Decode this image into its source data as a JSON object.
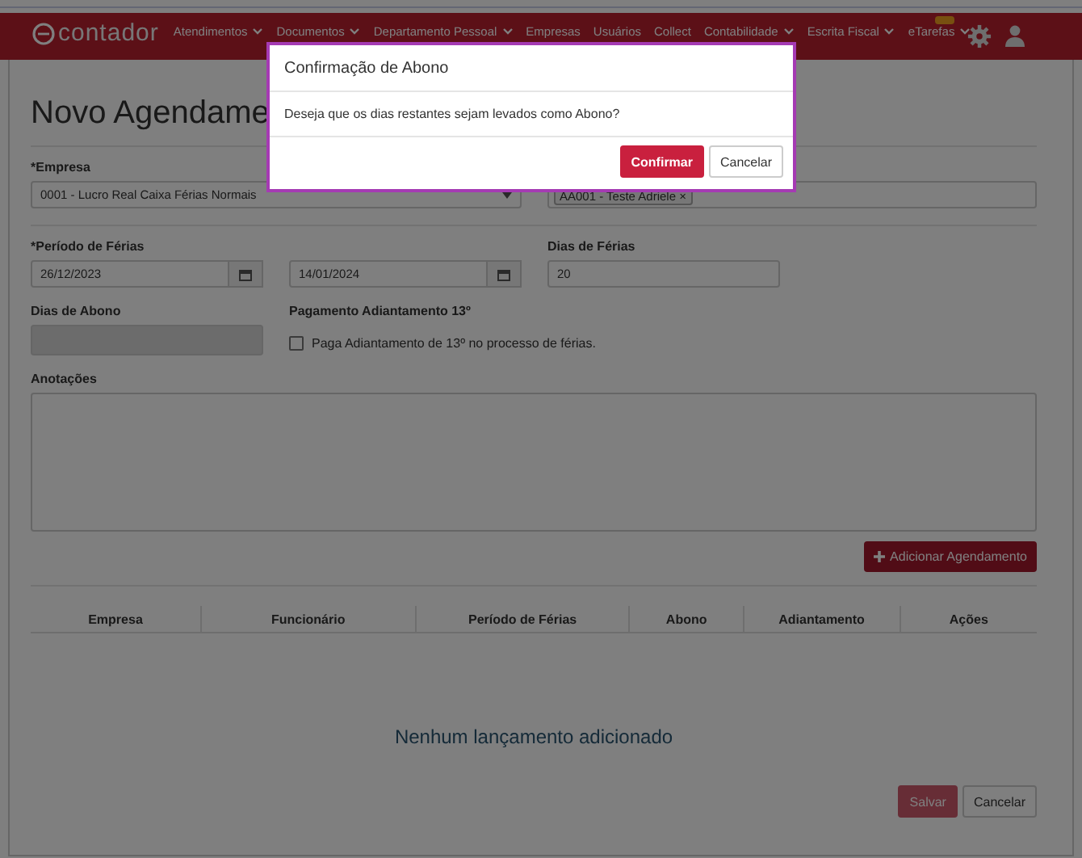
{
  "navbar": {
    "logo": "contador",
    "items": [
      {
        "label": "Atendimentos",
        "dropdown": true
      },
      {
        "label": "Documentos",
        "dropdown": true
      },
      {
        "label": "Departamento Pessoal",
        "dropdown": true
      },
      {
        "label": "Empresas",
        "dropdown": false
      },
      {
        "label": "Usuários",
        "dropdown": false
      },
      {
        "label": "Collect",
        "dropdown": false
      },
      {
        "label": "Contabilidade",
        "dropdown": true
      },
      {
        "label": "Escrita Fiscal",
        "dropdown": true
      },
      {
        "label": "eTarefas",
        "dropdown": true
      }
    ]
  },
  "page": {
    "title": "Novo Agendame",
    "empresa": {
      "label": "*Empresa",
      "value": "0001 - Lucro Real Caixa Férias Normais"
    },
    "funcionario": {
      "tag": "AA001 - Teste Adriele ×"
    },
    "periodo": {
      "label": "*Período de Férias",
      "start": "26/12/2023",
      "end": "14/01/2024"
    },
    "dias_ferias": {
      "label": "Dias de Férias",
      "value": "20"
    },
    "dias_abono": {
      "label": "Dias de Abono",
      "disabled": true
    },
    "adiantamento": {
      "label": "Pagamento Adiantamento 13º",
      "checkbox": "Paga Adiantamento de 13º no processo de férias.",
      "checked": false
    },
    "anotacoes": {
      "label": "Anotações"
    },
    "add_button": "Adicionar Agendamento",
    "table": {
      "columns": [
        "Empresa",
        "Funcionário",
        "Período de Férias",
        "Abono",
        "Adiantamento",
        "Ações"
      ],
      "empty": "Nenhum lançamento adicionado"
    },
    "buttons": [
      {
        "label": "Salvar",
        "kind": "primary",
        "disabled": true
      },
      {
        "label": "Cancelar",
        "kind": "default",
        "disabled": false
      }
    ]
  },
  "modal": {
    "title": "Confirmação de Abono",
    "message": "Deseja que os dias restantes sejam levados como Abono?",
    "buttons": [
      {
        "label": "Confirmar",
        "kind": "primary"
      },
      {
        "label": "Cancelar",
        "kind": "default"
      }
    ]
  }
}
